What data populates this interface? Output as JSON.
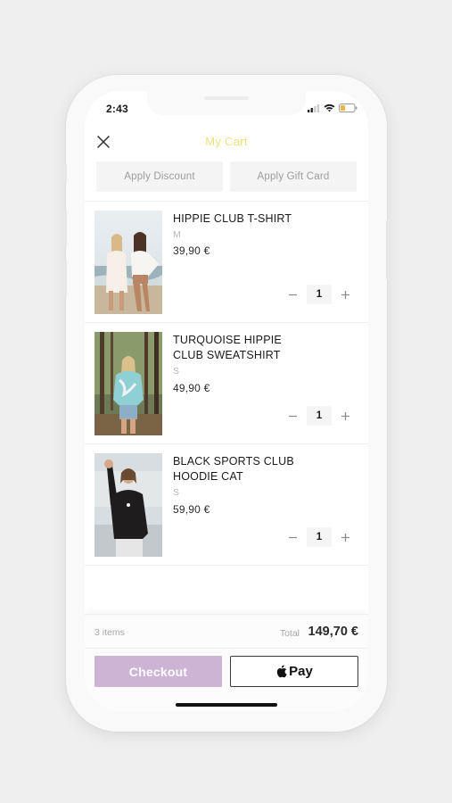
{
  "status_bar": {
    "time": "2:43"
  },
  "header": {
    "title": "My Cart"
  },
  "promo": {
    "discount_label": "Apply Discount",
    "gift_card_label": "Apply Gift Card"
  },
  "cart": {
    "items": [
      {
        "name": "HIPPIE CLUB T-SHIRT",
        "size": "M",
        "price": "39,90 €",
        "quantity": "1"
      },
      {
        "name": "TURQUOISE HIPPIE CLUB SWEATSHIRT",
        "size": "S",
        "price": "49,90 €",
        "quantity": "1"
      },
      {
        "name": "BLACK SPORTS CLUB HOODIE CAT",
        "size": "S",
        "price": "59,90 €",
        "quantity": "1"
      }
    ]
  },
  "summary": {
    "items_count": "3 items",
    "total_label": "Total",
    "total_value": "149,70 €"
  },
  "actions": {
    "checkout_label": "Checkout",
    "applepay_label": "Pay"
  },
  "colors": {
    "title": "#f1df7c",
    "checkout": "#cdb3d4"
  }
}
